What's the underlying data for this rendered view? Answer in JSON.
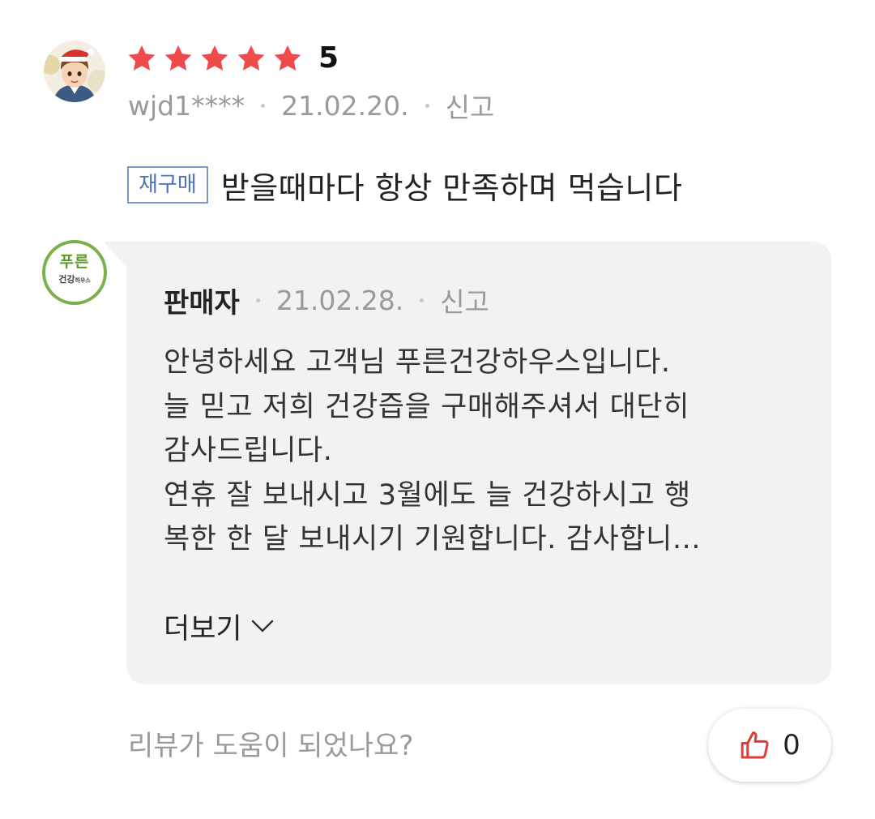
{
  "review": {
    "rating": "5",
    "star_count": 5,
    "star_color": "#f04b4b",
    "author": "wjd1****",
    "date": "21.02.20.",
    "report_label": "신고",
    "badge_label": "재구매",
    "text": "받을때마다 항상 만족하며 먹습니다"
  },
  "seller_reply": {
    "logo_text_top": "푸른",
    "logo_text_bottom": "건강",
    "logo_text_sub": "하우스",
    "name": "판매자",
    "date": "21.02.28.",
    "report_label": "신고",
    "lines": [
      "안녕하세요 고객님 푸른건강하우스입니다.",
      "늘 믿고 저희 건강즙을 구매해주셔서 대단히",
      "감사드립니다.",
      "연휴 잘 보내시고 3월에도 늘 건강하시고 행",
      "복한 한 달 보내시기 기원합니다. 감사합니..."
    ],
    "more_label": "더보기"
  },
  "helpful": {
    "question": "리뷰가 도움이 되었나요?",
    "like_count": "0",
    "like_icon": "thumbs-up-icon",
    "like_color": "#e23b3b"
  }
}
